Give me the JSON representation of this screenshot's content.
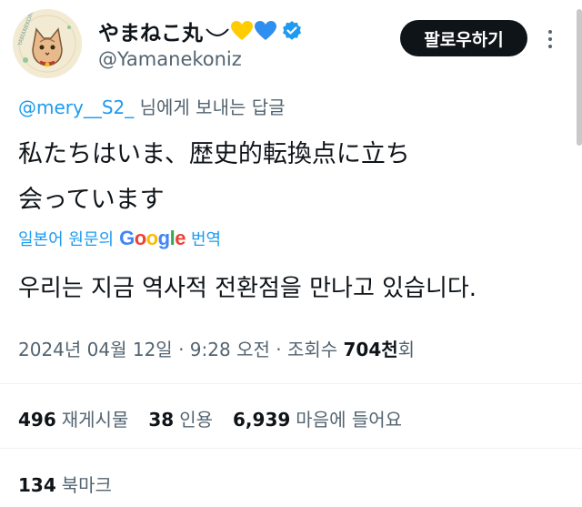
{
  "author": {
    "display_name": "やまねこ丸",
    "handle": "@Yamanekoniz",
    "avatar_text": "YAMANEKOMARU"
  },
  "follow_button": "팔로우하기",
  "reply": {
    "mention": "@mery__S2_",
    "suffix": " 님에게 보내는 답글"
  },
  "tweet": {
    "lines": [
      "私たちはいま、歴史的転換点に立ち",
      "会っています"
    ]
  },
  "translation": {
    "prefix": "일본어 원문의",
    "suffix": "번역",
    "text": "우리는 지금 역사적 전환점을 만나고 있습니다."
  },
  "meta": {
    "date": "2024년 04월 12일",
    "time": "9:28 오전",
    "views_label": "조회수",
    "views_count": "704천",
    "views_suffix": "회"
  },
  "stats": {
    "retweets": {
      "count": "496",
      "label": "재게시물"
    },
    "quotes": {
      "count": "38",
      "label": "인용"
    },
    "likes": {
      "count": "6,939",
      "label": "마음에 들어요"
    },
    "bookmarks": {
      "count": "134",
      "label": "북마크"
    }
  },
  "colors": {
    "accent": "#1d9bf0",
    "text": "#0f1419",
    "muted": "#536471",
    "heart_yellow": "#ffcc00",
    "heart_blue": "#2f8ff0"
  }
}
